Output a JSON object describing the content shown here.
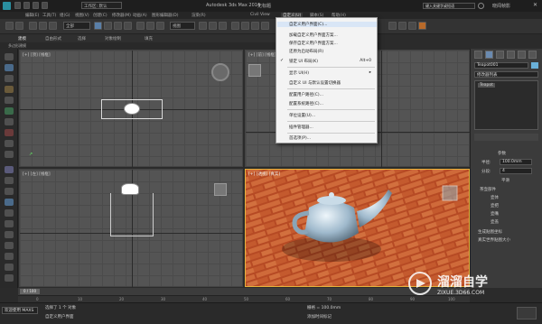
{
  "titlebar": {
    "workspace": "工作区: 默认",
    "app_title": "Autodesk 3ds Max 2016",
    "doc_title": "无标题",
    "search_placeholder": "键入关键字或短语",
    "user": "晓闻帧影"
  },
  "menubar": [
    "编辑(E)",
    "工具(T)",
    "组(G)",
    "视图(V)",
    "创建(C)",
    "修改器(M)",
    "动画(A)",
    "图形编辑器(D)",
    "渲染(R)",
    "Civil View",
    "自定义(U)",
    "脚本(S)",
    "帮助(H)"
  ],
  "toolbar": {
    "selection_set": "全部",
    "view_select": "视图"
  },
  "ribbon": {
    "tabs": [
      "建模",
      "自由形式",
      "选择",
      "对象绘制",
      "填充"
    ],
    "sub": "多边形建模"
  },
  "viewports": [
    {
      "label": "[+] [顶] [线框]"
    },
    {
      "label": "[+] [前] [线框]"
    },
    {
      "label": "[+] [左] [线框]"
    },
    {
      "label": "[+] [透视] [真实]"
    }
  ],
  "menu": {
    "items": [
      {
        "label": "自定义用户界面(C)...",
        "shortcut": ""
      },
      {
        "label": "加载自定义用户界面方案...",
        "shortcut": ""
      },
      {
        "label": "保存自定义用户界面方案...",
        "shortcut": ""
      },
      {
        "label": "还原为启动布局(R)",
        "shortcut": ""
      },
      {
        "label": "锁定 UI 布局(K)",
        "shortcut": "Alt+0",
        "checked": true
      },
      {
        "label": "显示 UI(H)",
        "shortcut": "▸"
      },
      {
        "label": "自定义 UI 与默认设置切换器",
        "shortcut": ""
      },
      {
        "label": "配置用户路径(C)...",
        "shortcut": ""
      },
      {
        "label": "配置系统路径(C)...",
        "shortcut": ""
      },
      {
        "label": "单位设置(U)...",
        "shortcut": ""
      },
      {
        "label": "插件管理器...",
        "shortcut": ""
      },
      {
        "label": "首选项(P)...",
        "shortcut": ""
      }
    ]
  },
  "cmdpanel": {
    "object_name": "Teapot001",
    "modifier_list": "修改器列表",
    "stack_item": "Teapot",
    "rollout": "参数",
    "radius_label": "半径:",
    "radius_value": "100.0mm",
    "segments_label": "分段:",
    "segments_value": "4",
    "smooth_label": "平滑",
    "parts_label": "茶壶部件",
    "parts": [
      "壶体",
      "壶把",
      "壶嘴",
      "壶盖"
    ],
    "gen_map": "生成贴图坐标",
    "real_world": "真实世界贴图大小"
  },
  "timeline": {
    "frame": "0 / 100",
    "ticks": [
      "0",
      "10",
      "20",
      "30",
      "40",
      "50",
      "60",
      "70",
      "80",
      "90",
      "100"
    ]
  },
  "status": {
    "welcome": "欢迎使用 MAXS",
    "selection": "选择了 1 个 对象",
    "prompt": "自定义用户界面",
    "grid": "栅格 = 100.0mm",
    "add_time_tag": "添加时间标记"
  },
  "watermark": {
    "site": "溜溜自学",
    "url": "ZIXUE.3D66.COM"
  },
  "colors": {
    "accent": "#e6b23b",
    "menu_highlight": "#d9e6f6",
    "brick": "#c4532c",
    "teapot": "#a9c3d6"
  }
}
